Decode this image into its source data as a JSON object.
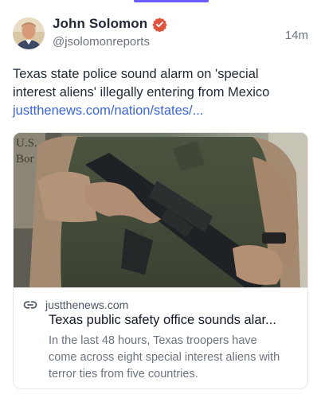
{
  "post": {
    "author_name": "John Solomon",
    "author_handle": "@jsolomonreports",
    "timestamp": "14m",
    "verified_icon": "verified-badge-icon",
    "text_lines": [
      "Texas state police sound alarm on 'special",
      "interest aliens' illegally entering from Mexico"
    ],
    "link_text": "justthenews.com/nation/states/..."
  },
  "card": {
    "domain": "justthenews.com",
    "title": "Texas public safety office sounds alar...",
    "description_lines": [
      "In the last 48 hours, Texas troopers have",
      "come across eight special interest aliens with",
      "terror ties from five countries."
    ],
    "link_icon": "link-icon",
    "image_sign_text": [
      "U.S.",
      "Bor"
    ]
  },
  "colors": {
    "accent": "#6d5dfc",
    "link": "#3b66d6",
    "verified": "#e0543e"
  }
}
